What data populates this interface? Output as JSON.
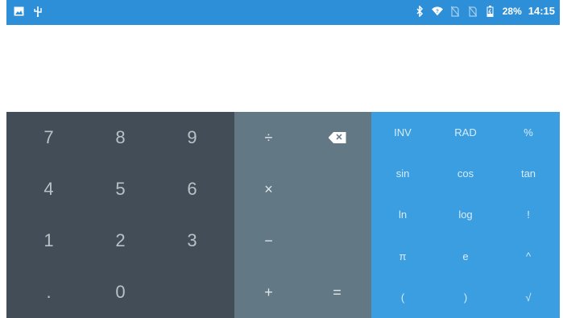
{
  "statusbar": {
    "left_icons": [
      "image-icon",
      "usb-icon"
    ],
    "right_icons": [
      "bluetooth-icon",
      "wifi-icon",
      "no-sim-icon",
      "no-sim-icon",
      "battery-icon"
    ],
    "battery": "28%",
    "time": "14:15"
  },
  "display": {
    "value": ""
  },
  "numpad": {
    "keys": [
      "7",
      "8",
      "9",
      "4",
      "5",
      "6",
      "1",
      "2",
      "3",
      ".",
      "0",
      ""
    ]
  },
  "ops": {
    "divide": "÷",
    "delete_icon": "backspace-icon",
    "multiply": "×",
    "minus": "−",
    "plus": "+",
    "equals": "="
  },
  "sci": {
    "keys": [
      "INV",
      "RAD",
      "%",
      "sin",
      "cos",
      "tan",
      "ln",
      "log",
      "!",
      "π",
      "e",
      "^",
      "(",
      ")",
      "√"
    ]
  },
  "colors": {
    "statusbar": "#2d8fd7",
    "numpad_bg": "#424d57",
    "ops_bg": "#637885",
    "sci_bg": "#3a9ee0"
  }
}
